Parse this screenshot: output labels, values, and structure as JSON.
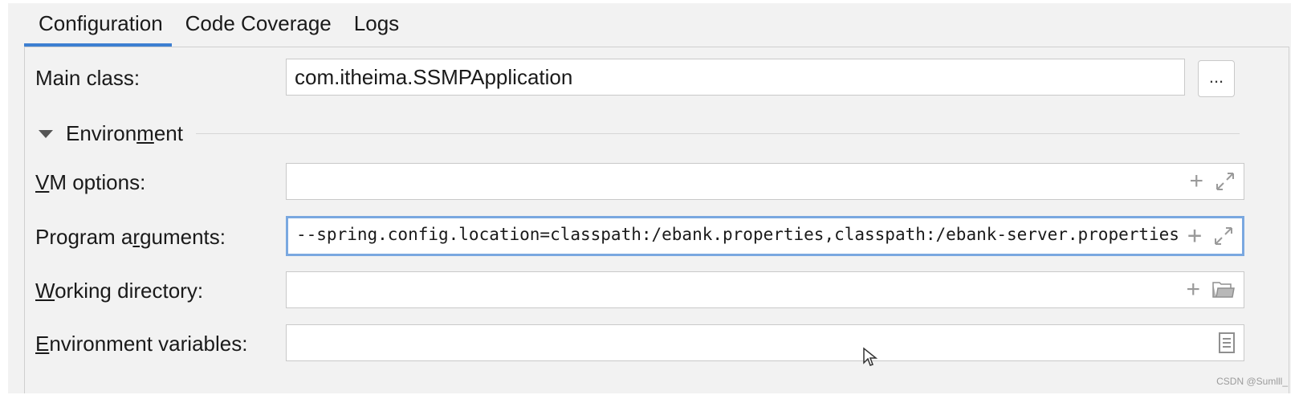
{
  "tabs": [
    {
      "label": "Configuration"
    },
    {
      "label": "Code Coverage"
    },
    {
      "label": "Logs"
    }
  ],
  "form": {
    "main_class": {
      "label": "Main class:",
      "value": "com.itheima.SSMPApplication",
      "browse_label": "..."
    },
    "environment_section": {
      "label_pre": "Environ",
      "label_mnemonic": "m",
      "label_post": "ent",
      "expanded": true
    },
    "vm_options": {
      "label_mnemonic": "V",
      "label_rest": "M options:",
      "value": ""
    },
    "program_arguments": {
      "label_pre": "Program a",
      "label_mnemonic": "r",
      "label_post": "guments:",
      "value": "--spring.config.location=classpath:/ebank.properties,classpath:/ebank-server.properties"
    },
    "working_directory": {
      "label_mnemonic": "W",
      "label_rest": "orking directory:",
      "value": ""
    },
    "environment_variables": {
      "label_mnemonic": "E",
      "label_rest": "nvironment variables:",
      "value": ""
    }
  },
  "watermark": "CSDN @Sumlll_",
  "colors": {
    "accent": "#3d7fd1",
    "focus_border": "#7aa8e0",
    "background": "#f2f2f2"
  }
}
